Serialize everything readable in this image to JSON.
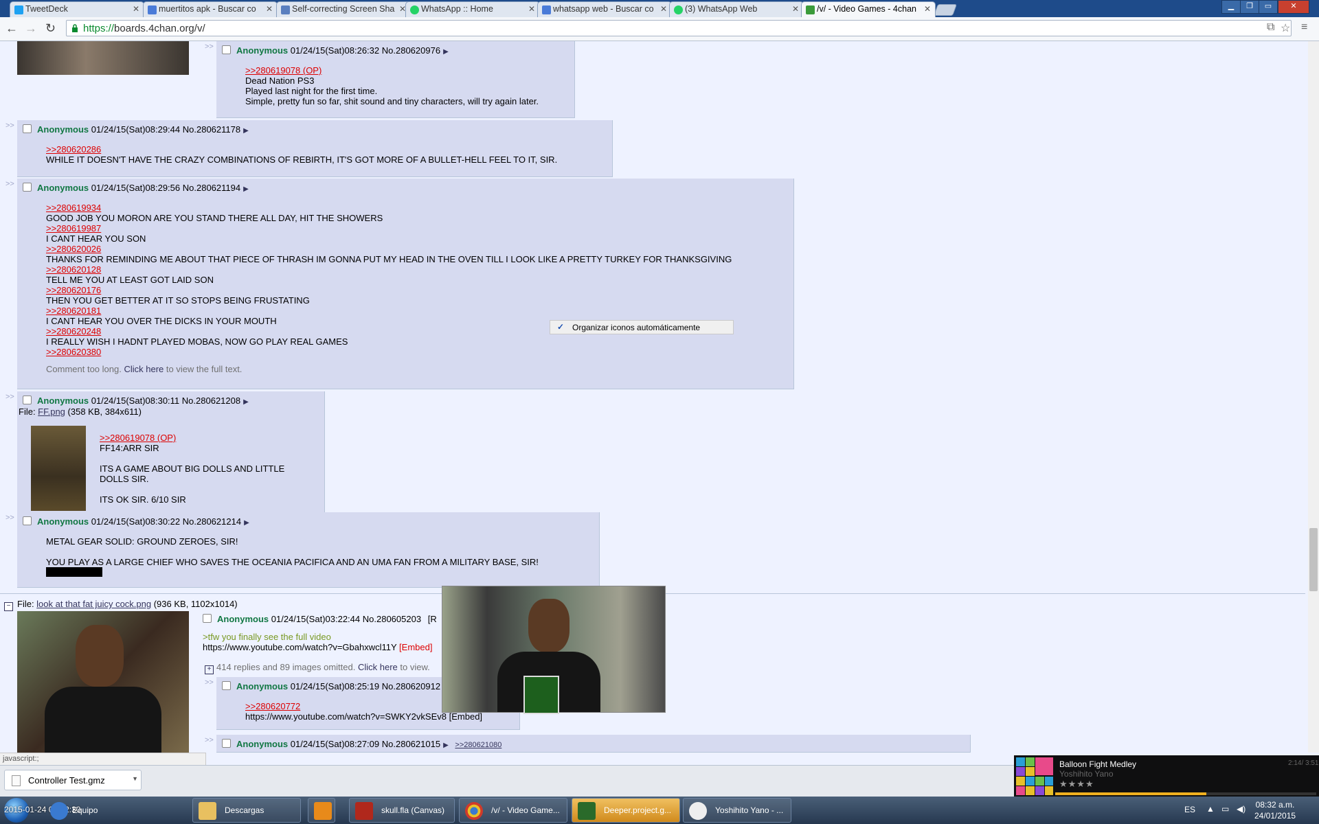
{
  "browser": {
    "tabs": [
      {
        "title": "TweetDeck",
        "icon": "twitter-icon",
        "color": "#1da1f2"
      },
      {
        "title": "muertitos apk - Buscar co",
        "icon": "google-icon",
        "color": "#4a7bd8"
      },
      {
        "title": "Self-correcting Screen Sha",
        "icon": "page-icon",
        "color": "#5a7fbf"
      },
      {
        "title": "WhatsApp :: Home",
        "icon": "whatsapp-icon",
        "color": "#25d366"
      },
      {
        "title": "whatsapp web - Buscar co",
        "icon": "google-icon",
        "color": "#4a7bd8"
      },
      {
        "title": "(3) WhatsApp Web",
        "icon": "whatsapp-icon",
        "color": "#25d366"
      },
      {
        "title": "/v/ - Video Games - 4chan",
        "icon": "clover-icon",
        "color": "#3b9b3b"
      }
    ],
    "url_https": "https://",
    "url_rest": "boards.4chan.org/v/"
  },
  "posts": {
    "p976": {
      "name": "Anonymous",
      "date": "01/24/15(Sat)08:26:32",
      "no": "No.280620976",
      "quote": ">>280619078 (OP)",
      "lines": [
        "Dead Nation PS3",
        "Played last night for the first time.",
        "Simple, pretty fun so far, shit sound and tiny characters, will try again later."
      ]
    },
    "p178": {
      "name": "Anonymous",
      "date": "01/24/15(Sat)08:29:44",
      "no": "No.280621178",
      "quote": ">>280620286",
      "line": "WHILE IT DOESN'T HAVE THE CRAZY COMBINATIONS OF REBIRTH, IT'S GOT MORE OF A BULLET-HELL FEEL TO IT, SIR."
    },
    "p194": {
      "name": "Anonymous",
      "date": "01/24/15(Sat)08:29:56",
      "no": "No.280621194",
      "items": [
        {
          "q": ">>280619934",
          "t": "GOOD JOB YOU MORON ARE YOU STAND THERE ALL DAY, HIT THE SHOWERS"
        },
        {
          "q": ">>280619987",
          "t": "I CANT HEAR YOU SON"
        },
        {
          "q": ">>280620026",
          "t": "THANKS FOR REMINDING ME ABOUT THAT PIECE OF THRASH IM GONNA PUT MY HEAD IN THE OVEN TILL I LOOK LIKE A PRETTY TURKEY FOR THANKSGIVING"
        },
        {
          "q": ">>280620128",
          "t": "TELL ME YOU AT LEAST GOT LAID SON"
        },
        {
          "q": ">>280620176",
          "t": "THEN YOU GET BETTER AT IT SO STOPS BEING FRUSTATING"
        },
        {
          "q": ">>280620181",
          "t": "I CANT HEAR YOU OVER THE DICKS IN YOUR MOUTH"
        },
        {
          "q": ">>280620248",
          "t": "I REALLY WISH I HADNT PLAYED MOBAS, NOW GO PLAY REAL GAMES"
        },
        {
          "q": ">>280620380",
          "t": ""
        }
      ],
      "abbr_pre": "Comment too long. ",
      "abbr_link": "Click here",
      "abbr_post": " to view the full text."
    },
    "p208": {
      "name": "Anonymous",
      "date": "01/24/15(Sat)08:30:11",
      "no": "No.280621208",
      "file_label": "File: ",
      "file_name": "FF.png",
      "file_info": " (358 KB, 384x611)",
      "quote": ">>280619078 (OP)",
      "lines": [
        "FF14:ARR SIR",
        "",
        "ITS A GAME ABOUT BIG DOLLS AND LITTLE",
        "DOLLS SIR.",
        "",
        "ITS OK SIR. 6/10 SIR"
      ]
    },
    "p214": {
      "name": "Anonymous",
      "date": "01/24/15(Sat)08:30:22",
      "no": "No.280621214",
      "line1": "METAL GEAR SOLID: GROUND ZEROES, SIR!",
      "line2": "YOU PLAY AS A LARGE CHIEF WHO SAVES THE OCEANIA PACIFICA AND AN UMA FAN FROM A MILITARY BASE, SIR!"
    },
    "op2": {
      "file_label": "File: ",
      "file_name": "look at that fat juicy cock.png",
      "file_info": " (936 KB, 1102x1014)",
      "name": "Anonymous",
      "date": "01/24/15(Sat)03:22:44",
      "no": "No.280605203",
      "reply": "[R",
      "greentext": ">tfw you finally see the full video",
      "link": "https://www.youtube.com/watch?v=Gbahxwcl11Y",
      "embed": "[Embed]",
      "omitted": "414 replies and 89 images omitted. ",
      "omitted_link": "Click here",
      "omitted_post": " to view."
    },
    "p912": {
      "name": "Anonymous",
      "date": "01/24/15(Sat)08:25:19",
      "no": "No.280620912",
      "quote": ">>280620772",
      "link": "https://www.youtube.com/watch?v=SWKY2vkSEv8",
      "embed": "[Embed]"
    },
    "p015": {
      "name": "Anonymous",
      "date": "01/24/15(Sat)08:27:09",
      "no": "No.280621015",
      "backlink": ">>280621080"
    }
  },
  "context_menu": {
    "check": "✓",
    "label": "Organizar iconos automáticamente"
  },
  "status": "javascript:;",
  "download": {
    "file": "Controller Test.gmz"
  },
  "music": {
    "title": "Balloon Fight Medley",
    "artist": "Yoshihito Yano",
    "time": "2:14/ 3:51",
    "stars": "★★★★",
    "progress": 0.58
  },
  "taskbar": {
    "items": [
      {
        "label": "Equipo",
        "icon": "computer-icon"
      },
      {
        "label": "Descargas",
        "icon": "folder-icon"
      },
      {
        "label": "",
        "icon": "media-player-icon"
      },
      {
        "label": "skull.fla (Canvas)",
        "icon": "flash-icon"
      },
      {
        "label": "/v/ - Video Game...",
        "icon": "chrome-icon"
      },
      {
        "label": "Deeper.project.g...",
        "icon": "gamemaker-icon"
      },
      {
        "label": "Yoshihito Yano - ...",
        "icon": "music-player-icon"
      }
    ],
    "lang": "ES",
    "time": "08:32 a.m.",
    "date": "24/01/2015",
    "overlay_text": "2015-01-24 08:32:30"
  }
}
